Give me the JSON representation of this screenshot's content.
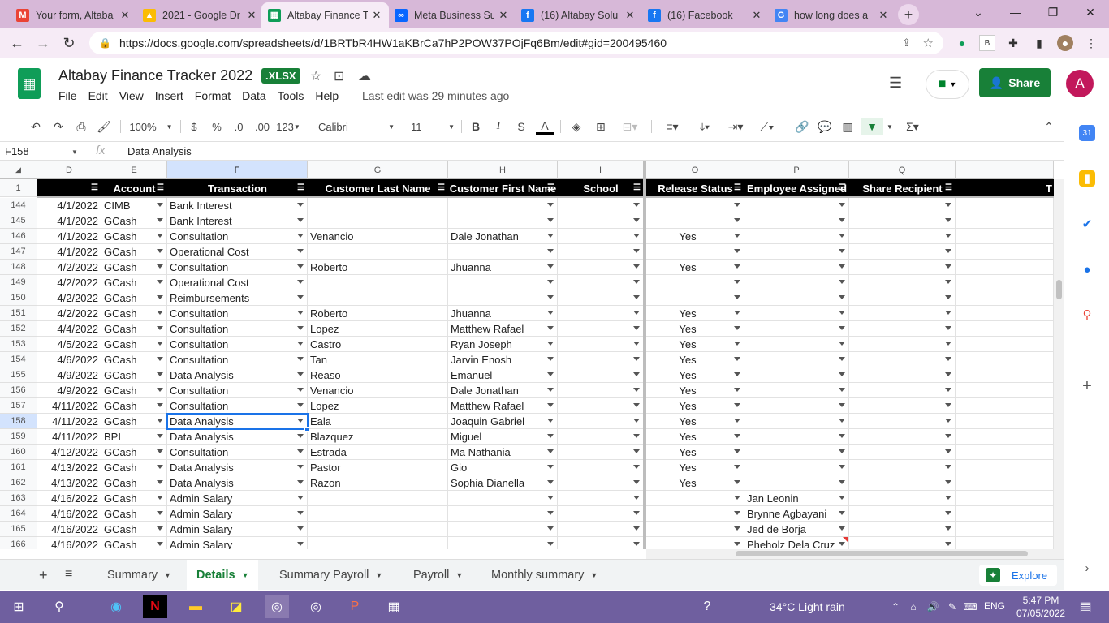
{
  "browser": {
    "tabs": [
      {
        "title": "Your form, Altaba",
        "icon": "gmail-icon",
        "color": "#ea4335",
        "glyph": "M"
      },
      {
        "title": "2021 - Google Dr",
        "icon": "drive-icon",
        "color": "#fbbc04",
        "glyph": "▲"
      },
      {
        "title": "Altabay Finance T",
        "icon": "sheets-icon",
        "color": "#0f9d58",
        "glyph": "▦"
      },
      {
        "title": "Meta Business Su",
        "icon": "meta-icon",
        "color": "#0866ff",
        "glyph": "∞"
      },
      {
        "title": "(16) Altabay Solu",
        "icon": "facebook-icon",
        "color": "#1877f2",
        "glyph": "f"
      },
      {
        "title": "(16) Facebook",
        "icon": "facebook-icon",
        "color": "#1877f2",
        "glyph": "f"
      },
      {
        "title": "how long does a",
        "icon": "google-icon",
        "color": "#4285f4",
        "glyph": "G"
      }
    ],
    "url": "https://docs.google.com/spreadsheets/d/1BRTbR4HW1aKBrCa7hP2POW37POjFq6Bm/edit#gid=200495460"
  },
  "doc": {
    "title": "Altabay Finance Tracker 2022",
    "badge": ".XLSX",
    "menus": [
      "File",
      "Edit",
      "View",
      "Insert",
      "Format",
      "Data",
      "Tools",
      "Help"
    ],
    "last_edit": "Last edit was 29 minutes ago",
    "share_label": "Share",
    "avatar_letter": "A"
  },
  "toolbar": {
    "zoom": "100%",
    "currency": "$",
    "percent": "%",
    "dec_dec": ".0",
    "dec_inc": ".00",
    "format": "123",
    "font": "Calibri",
    "size": "11"
  },
  "formula_bar": {
    "cell": "F158",
    "fx": "fx",
    "value": "Data Analysis"
  },
  "columns": {
    "letters": [
      "D",
      "E",
      "F",
      "G",
      "H",
      "I",
      "O",
      "P",
      "Q"
    ],
    "headers": [
      "",
      "Account",
      "Transaction",
      "Customer Last Name",
      "Customer First Name",
      "School",
      "Release Status",
      "Employee Assigned",
      "Share Recipient",
      "T"
    ],
    "header_row_num": "1"
  },
  "rows": [
    {
      "n": "144",
      "d": "4/1/2022",
      "e": "CIMB",
      "f": "Bank Interest",
      "g": "",
      "h": "",
      "o": "",
      "p": ""
    },
    {
      "n": "145",
      "d": "4/1/2022",
      "e": "GCash",
      "f": "Bank Interest",
      "g": "",
      "h": "",
      "o": "",
      "p": ""
    },
    {
      "n": "146",
      "d": "4/1/2022",
      "e": "GCash",
      "f": "Consultation",
      "g": "Venancio",
      "h": "Dale Jonathan",
      "o": "Yes",
      "p": ""
    },
    {
      "n": "147",
      "d": "4/1/2022",
      "e": "GCash",
      "f": "Operational Cost",
      "g": "",
      "h": "",
      "o": "",
      "p": ""
    },
    {
      "n": "148",
      "d": "4/2/2022",
      "e": "GCash",
      "f": "Consultation",
      "g": "Roberto",
      "h": "Jhuanna",
      "o": "Yes",
      "p": ""
    },
    {
      "n": "149",
      "d": "4/2/2022",
      "e": "GCash",
      "f": "Operational Cost",
      "g": "",
      "h": "",
      "o": "",
      "p": ""
    },
    {
      "n": "150",
      "d": "4/2/2022",
      "e": "GCash",
      "f": "Reimbursements",
      "g": "",
      "h": "",
      "o": "",
      "p": ""
    },
    {
      "n": "151",
      "d": "4/2/2022",
      "e": "GCash",
      "f": "Consultation",
      "g": "Roberto",
      "h": "Jhuanna",
      "o": "Yes",
      "p": ""
    },
    {
      "n": "152",
      "d": "4/4/2022",
      "e": "GCash",
      "f": "Consultation",
      "g": "Lopez",
      "h": "Matthew Rafael",
      "o": "Yes",
      "p": ""
    },
    {
      "n": "153",
      "d": "4/5/2022",
      "e": "GCash",
      "f": "Consultation",
      "g": "Castro",
      "h": "Ryan Joseph",
      "o": "Yes",
      "p": ""
    },
    {
      "n": "154",
      "d": "4/6/2022",
      "e": "GCash",
      "f": "Consultation",
      "g": "Tan",
      "h": "Jarvin Enosh",
      "o": "Yes",
      "p": ""
    },
    {
      "n": "155",
      "d": "4/9/2022",
      "e": "GCash",
      "f": "Data Analysis",
      "g": "Reaso",
      "h": "Emanuel",
      "o": "Yes",
      "p": ""
    },
    {
      "n": "156",
      "d": "4/9/2022",
      "e": "GCash",
      "f": "Consultation",
      "g": "Venancio",
      "h": "Dale Jonathan",
      "o": "Yes",
      "p": ""
    },
    {
      "n": "157",
      "d": "4/11/2022",
      "e": "GCash",
      "f": "Consultation",
      "g": "Lopez",
      "h": "Matthew Rafael",
      "o": "Yes",
      "p": ""
    },
    {
      "n": "158",
      "d": "4/11/2022",
      "e": "GCash",
      "f": "Data Analysis",
      "g": "Eala",
      "h": "Joaquin Gabriel",
      "o": "Yes",
      "p": ""
    },
    {
      "n": "159",
      "d": "4/11/2022",
      "e": "BPI",
      "f": "Data Analysis",
      "g": "Blazquez",
      "h": "Miguel",
      "o": "Yes",
      "p": ""
    },
    {
      "n": "160",
      "d": "4/12/2022",
      "e": "GCash",
      "f": "Consultation",
      "g": "Estrada",
      "h": "Ma Nathania",
      "o": "Yes",
      "p": ""
    },
    {
      "n": "161",
      "d": "4/13/2022",
      "e": "GCash",
      "f": "Data Analysis",
      "g": "Pastor",
      "h": "Gio",
      "o": "Yes",
      "p": ""
    },
    {
      "n": "162",
      "d": "4/13/2022",
      "e": "GCash",
      "f": "Data Analysis",
      "g": "Razon",
      "h": "Sophia Dianella",
      "o": "Yes",
      "p": ""
    },
    {
      "n": "163",
      "d": "4/16/2022",
      "e": "GCash",
      "f": "Admin Salary",
      "g": "",
      "h": "",
      "o": "",
      "p": "Jan Leonin"
    },
    {
      "n": "164",
      "d": "4/16/2022",
      "e": "GCash",
      "f": "Admin Salary",
      "g": "",
      "h": "",
      "o": "",
      "p": "Brynne Agbayani"
    },
    {
      "n": "165",
      "d": "4/16/2022",
      "e": "GCash",
      "f": "Admin Salary",
      "g": "",
      "h": "",
      "o": "",
      "p": "Jed de Borja"
    },
    {
      "n": "166",
      "d": "4/16/2022",
      "e": "GCash",
      "f": "Admin Salary",
      "g": "",
      "h": "",
      "o": "",
      "p": "Pheholz Dela Cruz"
    }
  ],
  "sheet_tabs": [
    {
      "label": "Summary",
      "active": false
    },
    {
      "label": "Details",
      "active": true
    },
    {
      "label": "Summary Payroll",
      "active": false
    },
    {
      "label": "Payroll",
      "active": false
    },
    {
      "label": "Monthly summary",
      "active": false
    }
  ],
  "explore_label": "Explore",
  "taskbar": {
    "weather": "34°C  Light rain",
    "lang": "ENG",
    "time": "5:47 PM",
    "date": "07/05/2022"
  }
}
